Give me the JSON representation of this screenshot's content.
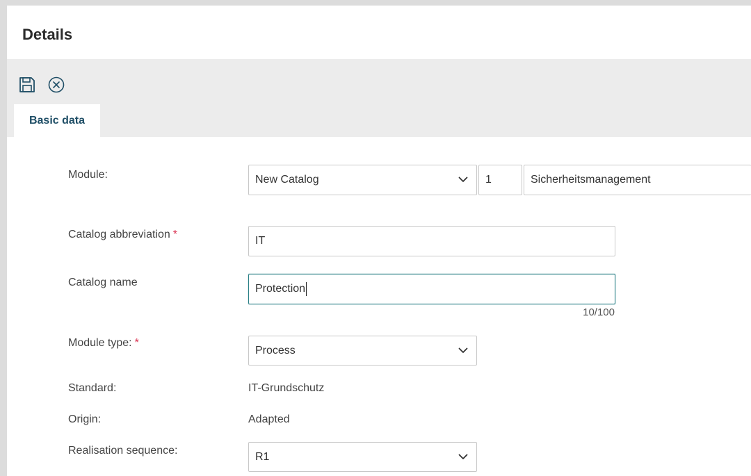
{
  "header": {
    "title": "Details"
  },
  "toolbar": {
    "save_icon": "floppy-disk-icon",
    "cancel_icon": "circle-x-icon"
  },
  "tabs": [
    {
      "label": "Basic data",
      "active": true
    }
  ],
  "form": {
    "module": {
      "label": "Module:",
      "catalog_value": "New Catalog",
      "number_value": "1",
      "name_value": "Sicherheitsmanagement"
    },
    "catalog_abbreviation": {
      "label": "Catalog abbreviation",
      "required_mark": "*",
      "value": "IT"
    },
    "catalog_name": {
      "label": "Catalog name",
      "value": "Protection",
      "counter": "10/100"
    },
    "module_type": {
      "label": "Module type:",
      "required_mark": "*",
      "value": "Process"
    },
    "standard": {
      "label": "Standard:",
      "value": "IT-Grundschutz"
    },
    "origin": {
      "label": "Origin:",
      "value": "Adapted"
    },
    "realisation_sequence": {
      "label": "Realisation sequence:",
      "value": "R1"
    }
  },
  "colors": {
    "accent": "#2a7f86",
    "tab_text": "#1f4e66",
    "required": "#d9304f",
    "toolbar_bg": "#ececec"
  }
}
